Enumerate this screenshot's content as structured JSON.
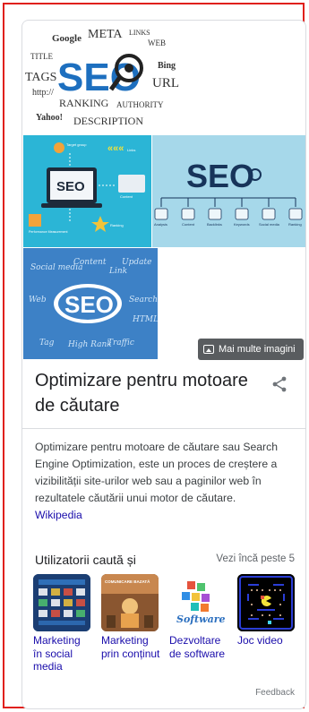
{
  "panel": {
    "title": "Optimizare pentru motoare de căutare",
    "more_images_label": "Mai multe imagini",
    "description": "Optimizare pentru motoare de căutare sau Search Engine Optimization, este un proces de creștere a vizibilității site-urilor web sau a paginilor web în rezultatele căutării unui motor de căutare.",
    "source_link": "Wikipedia"
  },
  "people_search": {
    "heading": "Utilizatorii caută și",
    "see_more": "Vezi încă peste 5",
    "items": [
      {
        "label": "Marketing în social media"
      },
      {
        "label": "Marketing prin conținut"
      },
      {
        "label": "Dezvoltare de software"
      },
      {
        "label": "Joc video"
      }
    ]
  },
  "images": {
    "wordcloud_words": [
      "Google",
      "META",
      "LINKS",
      "WEB",
      "TITLE",
      "SEO",
      "Bing",
      "TAGS",
      "URL",
      "http://",
      "RANKING",
      "AUTHORITY",
      "Yahoo!",
      "DESCRIPTION"
    ],
    "img2_words": [
      "SEO",
      "Target group",
      "Links",
      "Content",
      "Performance Measurement",
      "Ranking"
    ],
    "img3_words": [
      "SEO",
      "Analysis",
      "Content",
      "Backlinks",
      "Keywords",
      "Social media",
      "Ranking"
    ],
    "img4_words": [
      "SEO",
      "Social media",
      "Content",
      "Link",
      "Update",
      "Web",
      "Traffic",
      "Tag",
      "HTML",
      "High Rank",
      "Search"
    ],
    "thumb_words": {
      "marketing_prin": "COMUNICARE BAZATĂ",
      "dezvoltare": "Software"
    }
  },
  "footer": {
    "feedback": "Feedback"
  },
  "colors": {
    "frame": "#e0201b",
    "link": "#1a0dab",
    "seo_blue": "#1d6fbf"
  }
}
